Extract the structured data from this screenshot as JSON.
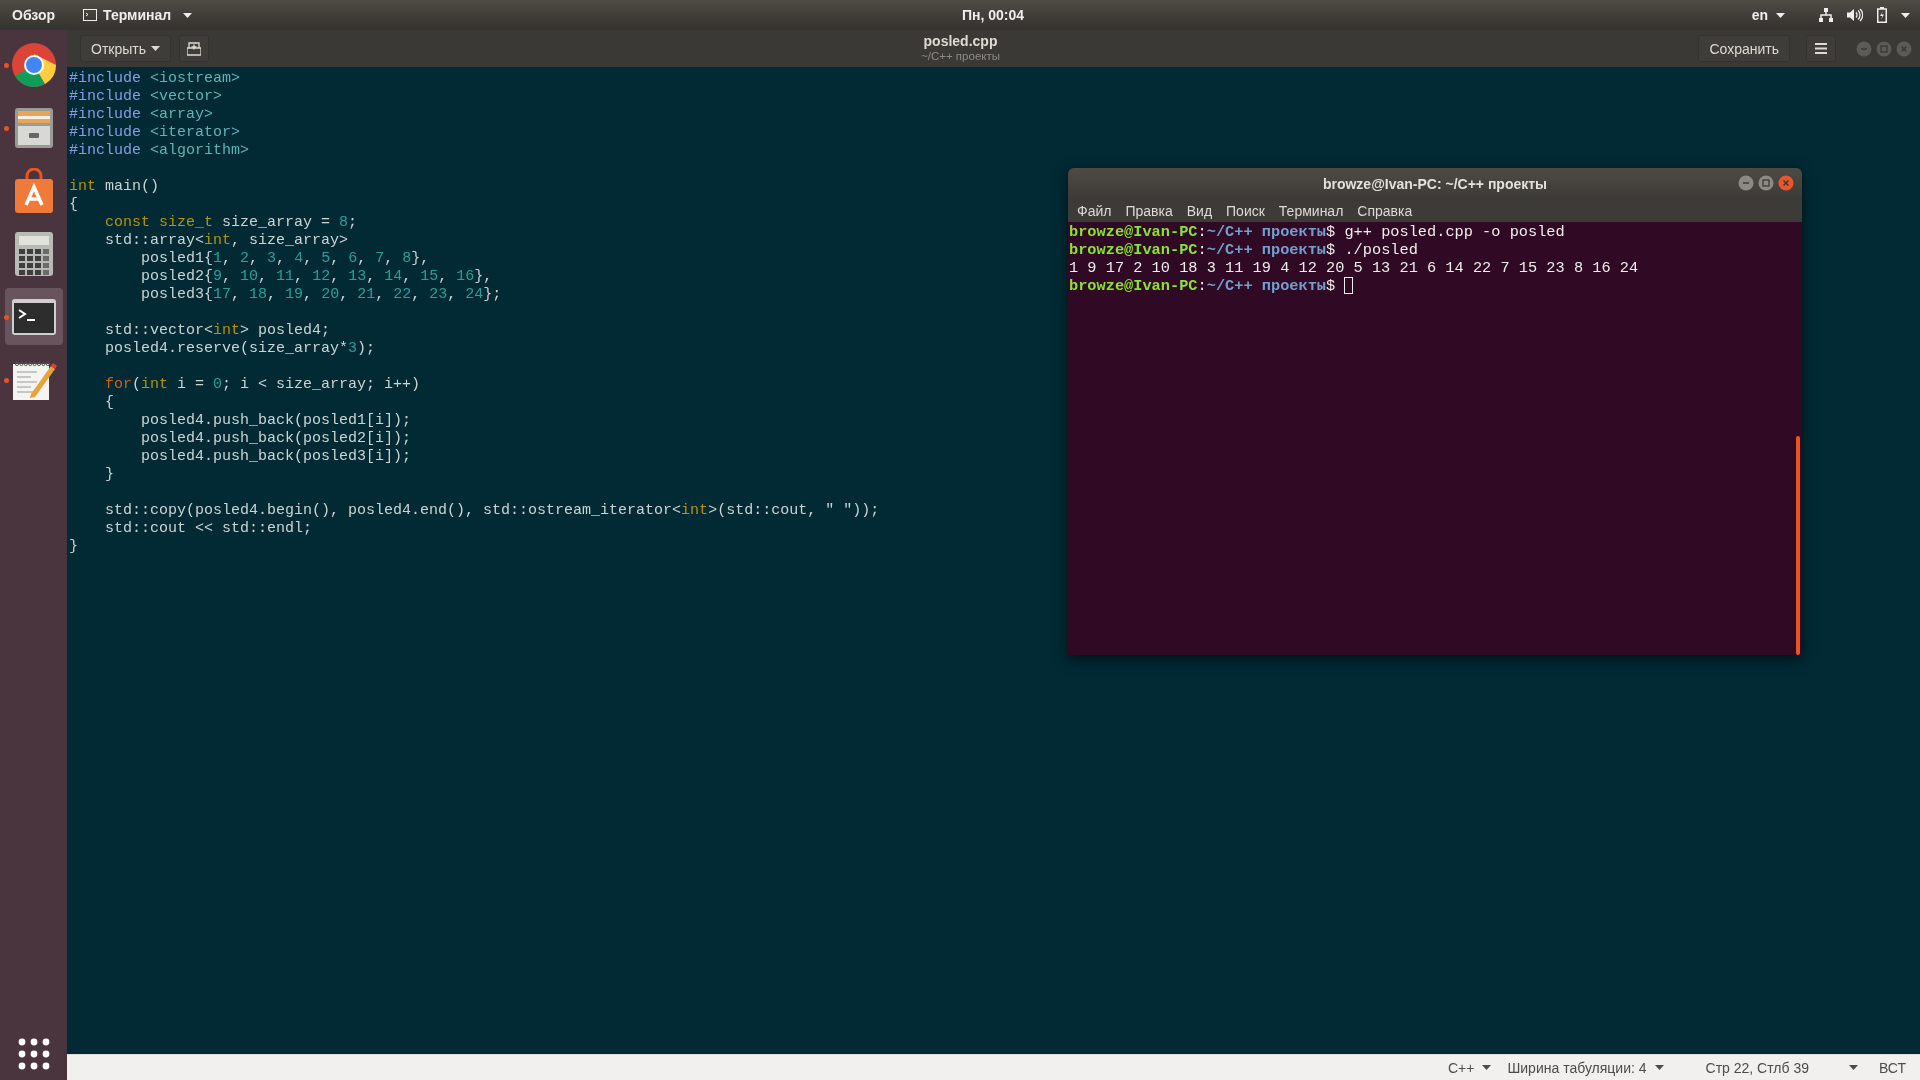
{
  "top_bar": {
    "activities": "Обзор",
    "app_menu": "Терминал",
    "clock": "Пн, 00:04",
    "keyboard_layout": "en"
  },
  "dock": {
    "items": [
      {
        "kind": "browser",
        "running": true,
        "selected": false
      },
      {
        "kind": "files",
        "running": true,
        "selected": false
      },
      {
        "kind": "store",
        "running": false,
        "selected": false
      },
      {
        "kind": "calculator",
        "running": false,
        "selected": false
      },
      {
        "kind": "terminal",
        "running": true,
        "selected": true
      },
      {
        "kind": "editor",
        "running": true,
        "selected": false
      }
    ]
  },
  "editor": {
    "open_button": "Открыть",
    "title": "posled.cpp",
    "subtitle": "~/C++ проекты",
    "save_button": "Сохранить",
    "code_blocks": [
      [
        [
          {
            "kind": "preproc",
            "text": "#include"
          },
          {
            "kind": "header",
            "text": " <iostream>"
          }
        ],
        [
          {
            "kind": "preproc",
            "text": "#include"
          },
          {
            "kind": "header",
            "text": " <vector>"
          }
        ],
        [
          {
            "kind": "preproc",
            "text": "#include"
          },
          {
            "kind": "header",
            "text": " <array>"
          }
        ],
        [
          {
            "kind": "preproc",
            "text": "#include"
          },
          {
            "kind": "header",
            "text": " <iterator>"
          }
        ],
        [
          {
            "kind": "preproc",
            "text": "#include"
          },
          {
            "kind": "header",
            "text": " <algorithm>"
          }
        ]
      ],
      [
        [
          {
            "kind": "type",
            "text": "int"
          },
          {
            "kind": "plain",
            "text": " main()"
          }
        ],
        [
          {
            "kind": "plain",
            "text": "{"
          }
        ],
        [
          {
            "kind": "type",
            "text": "    const size_t"
          },
          {
            "kind": "plain",
            "text": " size_array = "
          },
          {
            "kind": "number",
            "text": "8"
          },
          {
            "kind": "plain",
            "text": ";"
          }
        ],
        [
          {
            "kind": "plain",
            "text": "    std::array<"
          },
          {
            "kind": "type",
            "text": "int"
          },
          {
            "kind": "plain",
            "text": ", size_array>"
          }
        ],
        [
          {
            "kind": "plain",
            "text": "        posled1{"
          },
          {
            "kind": "number",
            "text": "1"
          },
          {
            "kind": "plain",
            "text": ", "
          },
          {
            "kind": "number",
            "text": "2"
          },
          {
            "kind": "plain",
            "text": ", "
          },
          {
            "kind": "number",
            "text": "3"
          },
          {
            "kind": "plain",
            "text": ", "
          },
          {
            "kind": "number",
            "text": "4"
          },
          {
            "kind": "plain",
            "text": ", "
          },
          {
            "kind": "number",
            "text": "5"
          },
          {
            "kind": "plain",
            "text": ", "
          },
          {
            "kind": "number",
            "text": "6"
          },
          {
            "kind": "plain",
            "text": ", "
          },
          {
            "kind": "number",
            "text": "7"
          },
          {
            "kind": "plain",
            "text": ", "
          },
          {
            "kind": "number",
            "text": "8"
          },
          {
            "kind": "plain",
            "text": "},"
          }
        ],
        [
          {
            "kind": "plain",
            "text": "        posled2{"
          },
          {
            "kind": "number",
            "text": "9"
          },
          {
            "kind": "plain",
            "text": ", "
          },
          {
            "kind": "number",
            "text": "10"
          },
          {
            "kind": "plain",
            "text": ", "
          },
          {
            "kind": "number",
            "text": "11"
          },
          {
            "kind": "plain",
            "text": ", "
          },
          {
            "kind": "number",
            "text": "12"
          },
          {
            "kind": "plain",
            "text": ", "
          },
          {
            "kind": "number",
            "text": "13"
          },
          {
            "kind": "plain",
            "text": ", "
          },
          {
            "kind": "number",
            "text": "14"
          },
          {
            "kind": "plain",
            "text": ", "
          },
          {
            "kind": "number",
            "text": "15"
          },
          {
            "kind": "plain",
            "text": ", "
          },
          {
            "kind": "number",
            "text": "16"
          },
          {
            "kind": "plain",
            "text": "},"
          }
        ],
        [
          {
            "kind": "plain",
            "text": "        posled3{"
          },
          {
            "kind": "number",
            "text": "17"
          },
          {
            "kind": "plain",
            "text": ", "
          },
          {
            "kind": "number",
            "text": "18"
          },
          {
            "kind": "plain",
            "text": ", "
          },
          {
            "kind": "number",
            "text": "19"
          },
          {
            "kind": "plain",
            "text": ", "
          },
          {
            "kind": "number",
            "text": "20"
          },
          {
            "kind": "plain",
            "text": ", "
          },
          {
            "kind": "number",
            "text": "21"
          },
          {
            "kind": "plain",
            "text": ", "
          },
          {
            "kind": "number",
            "text": "22"
          },
          {
            "kind": "plain",
            "text": ", "
          },
          {
            "kind": "number",
            "text": "23"
          },
          {
            "kind": "plain",
            "text": ", "
          },
          {
            "kind": "number",
            "text": "24"
          },
          {
            "kind": "plain",
            "text": "};"
          }
        ]
      ],
      [
        [
          {
            "kind": "plain",
            "text": "    std::vector<"
          },
          {
            "kind": "type",
            "text": "int"
          },
          {
            "kind": "plain",
            "text": "> posled4;"
          }
        ],
        [
          {
            "kind": "plain",
            "text": "    posled4.reserve(size_array*"
          },
          {
            "kind": "number",
            "text": "3"
          },
          {
            "kind": "plain",
            "text": ");"
          }
        ]
      ],
      [
        [
          {
            "kind": "control",
            "text": "    for"
          },
          {
            "kind": "plain",
            "text": "("
          },
          {
            "kind": "type",
            "text": "int"
          },
          {
            "kind": "plain",
            "text": " i = "
          },
          {
            "kind": "number",
            "text": "0"
          },
          {
            "kind": "plain",
            "text": "; i < size_array; i++)"
          }
        ],
        [
          {
            "kind": "plain",
            "text": "    {"
          }
        ],
        [
          {
            "kind": "plain",
            "text": "        posled4.push_back(posled1[i]);"
          }
        ],
        [
          {
            "kind": "plain",
            "text": "        posled4.push_back(posled2[i]);"
          }
        ],
        [
          {
            "kind": "plain",
            "text": "        posled4.push_back(posled3[i]);"
          }
        ],
        [
          {
            "kind": "plain",
            "text": "    }"
          }
        ]
      ],
      [
        [
          {
            "kind": "plain",
            "text": "    std::copy(posled4.begin(), posled4.end(), std::ostream_iterator<"
          },
          {
            "kind": "type",
            "text": "int"
          },
          {
            "kind": "plain",
            "text": ">(std::cout, \" \"));"
          }
        ],
        [
          {
            "kind": "plain",
            "text": "    std::cout << std::endl;"
          }
        ],
        [
          {
            "kind": "plain",
            "text": "}"
          }
        ]
      ]
    ]
  },
  "terminal": {
    "title": "browze@Ivan-PC: ~/C++ проекты",
    "menu": [
      "Файл",
      "Правка",
      "Вид",
      "Поиск",
      "Терминал",
      "Справка"
    ],
    "lines": [
      {
        "kind": "prompt",
        "user": "browze@Ivan-PC",
        "separator": ":",
        "path": "~/C++ проекты",
        "sign": "$",
        "command": "g++ posled.cpp -o posled",
        "cursor": false
      },
      {
        "kind": "prompt",
        "user": "browze@Ivan-PC",
        "separator": ":",
        "path": "~/C++ проекты",
        "sign": "$",
        "command": "./posled",
        "cursor": false
      },
      {
        "kind": "output",
        "text": "1 9 17 2 10 18 3 11 19 4 12 20 5 13 21 6 14 22 7 15 23 8 16 24"
      },
      {
        "kind": "prompt",
        "user": "browze@Ivan-PC",
        "separator": ":",
        "path": "~/C++ проекты",
        "sign": "$",
        "cursor": true
      }
    ]
  },
  "status_bar": {
    "language": "C++",
    "tab_width": "Ширина табуляции: 4",
    "position": "Стр 22, Стлб 39",
    "mode": "ВСТ"
  }
}
